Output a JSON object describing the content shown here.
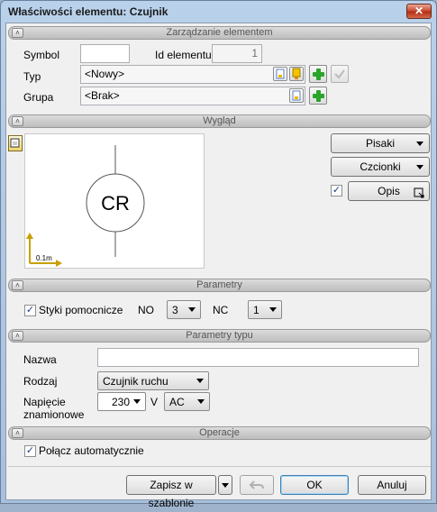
{
  "window": {
    "title": "Właściwości elementu: Czujnik",
    "close_label": "✕"
  },
  "sections": {
    "management": "Zarządzanie elementem",
    "appearance": "Wygląd",
    "parameters": "Parametry",
    "type_parameters": "Parametry typu",
    "operations": "Operacje"
  },
  "management": {
    "symbol_label": "Symbol",
    "symbol_value": "",
    "id_label": "Id elementu",
    "id_value": "1",
    "type_label": "Typ",
    "type_value": "<Nowy>",
    "group_label": "Grupa",
    "group_value": "<Brak>"
  },
  "appearance": {
    "symbol_text": "CR",
    "scale_label": "0.1m",
    "pens_button": "Pisaki",
    "fonts_button": "Czcionki",
    "description_checkbox_checked": true,
    "description_button": "Opis"
  },
  "parameters": {
    "aux_contacts_label": "Styki pomocnicze",
    "aux_contacts_checked": true,
    "no_label": "NO",
    "no_value": "3",
    "nc_label": "NC",
    "nc_value": "1"
  },
  "type_parameters": {
    "name_label": "Nazwa",
    "name_value": "",
    "kind_label": "Rodzaj",
    "kind_value": "Czujnik ruchu",
    "voltage_label_line1": "Napięcie",
    "voltage_label_line2": "znamionowe",
    "voltage_value": "230",
    "voltage_unit": "V",
    "current_type": "AC"
  },
  "operations": {
    "auto_connect_label": "Połącz automatycznie",
    "auto_connect_checked": true
  },
  "footer": {
    "save_template": "Zapisz w szablonie",
    "ok": "OK",
    "cancel": "Anuluj"
  },
  "colors": {
    "accent_green": "#2aa52a",
    "close_red": "#c9452c",
    "title_gradient": "#b9d1ea"
  }
}
